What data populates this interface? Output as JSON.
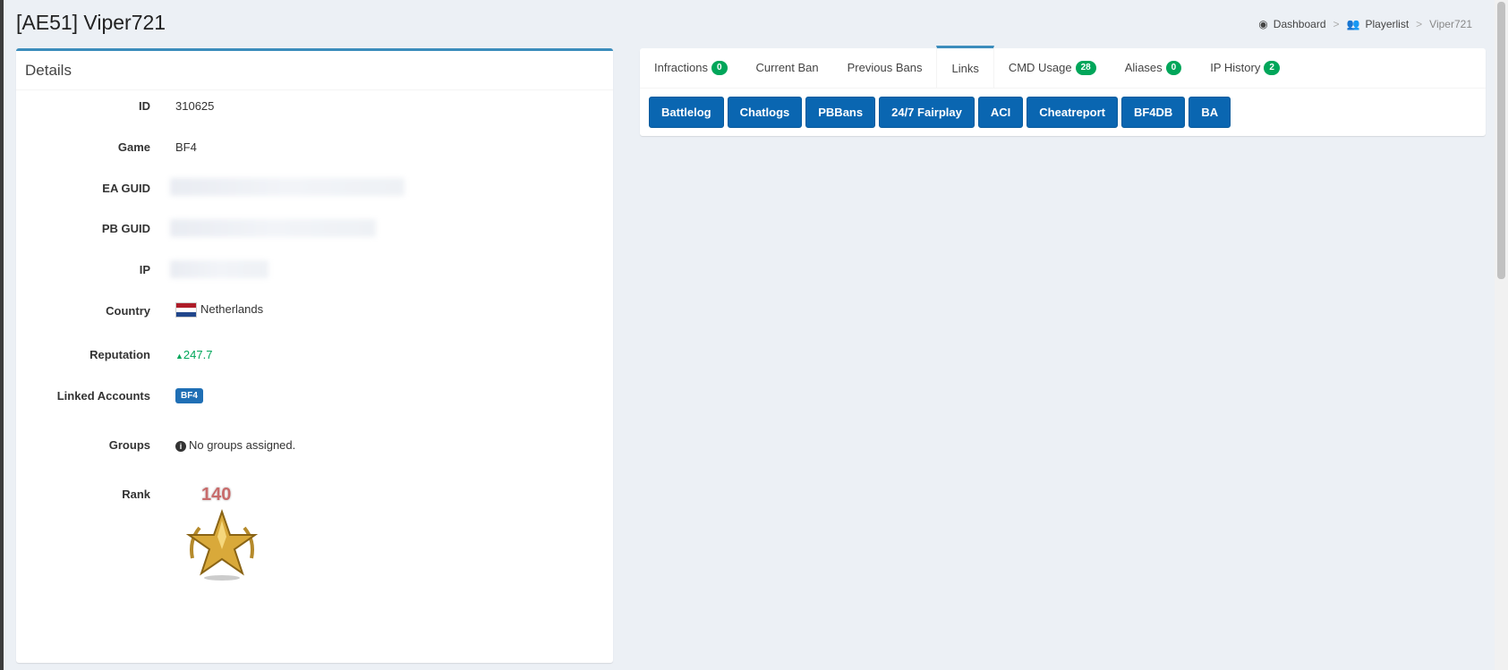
{
  "page": {
    "title": "[AE51] Viper721"
  },
  "breadcrumb": [
    {
      "label": "Dashboard",
      "icon": "dashboard-icon"
    },
    {
      "label": "Playerlist",
      "icon": "users-icon"
    },
    {
      "label": "Viper721"
    }
  ],
  "details": {
    "title": "Details",
    "id_label": "ID",
    "id_value": "310625",
    "game_label": "Game",
    "game_value": "BF4",
    "ea_guid_label": "EA GUID",
    "pb_guid_label": "PB GUID",
    "ip_label": "IP",
    "country_label": "Country",
    "country_value": "Netherlands",
    "reputation_label": "Reputation",
    "reputation_value": "247.7",
    "linked_label": "Linked Accounts",
    "linked_badge": "BF4",
    "groups_label": "Groups",
    "groups_value": "No groups assigned.",
    "rank_label": "Rank",
    "rank_value": "140"
  },
  "tabs": [
    {
      "label": "Infractions",
      "count": "0"
    },
    {
      "label": "Current Ban"
    },
    {
      "label": "Previous Bans"
    },
    {
      "label": "Links",
      "active": true
    },
    {
      "label": "CMD Usage",
      "count": "28"
    },
    {
      "label": "Aliases",
      "count": "0"
    },
    {
      "label": "IP History",
      "count": "2"
    }
  ],
  "links": [
    "Battlelog",
    "Chatlogs",
    "PBBans",
    "24/7 Fairplay",
    "ACI",
    "Cheatreport",
    "BF4DB",
    "BA"
  ],
  "colors": {
    "accent": "#3c8dbc",
    "success": "#00a65a",
    "button": "#0a66b1"
  }
}
